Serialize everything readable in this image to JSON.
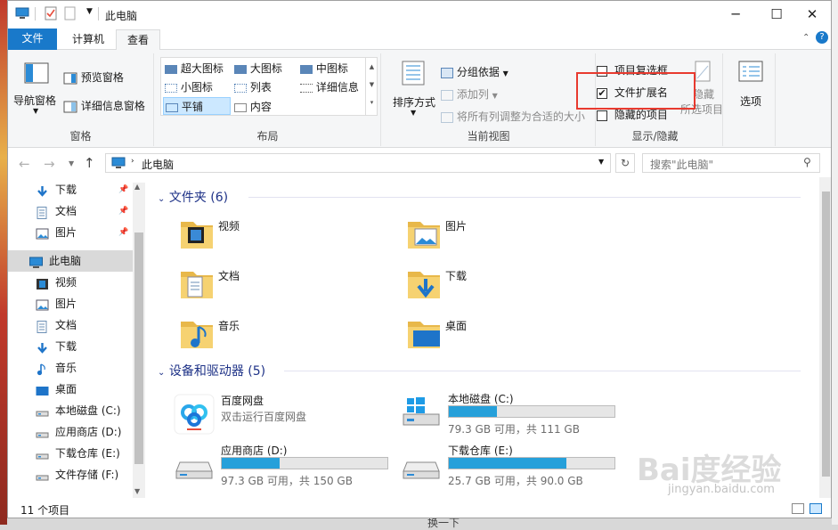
{
  "window": {
    "title": "此电脑"
  },
  "window_buttons": {
    "minimize": "─",
    "maximize": "☐",
    "close": "✕"
  },
  "tabs": [
    {
      "label": "文件"
    },
    {
      "label": "计算机"
    },
    {
      "label": "查看"
    }
  ],
  "ribbon": {
    "panes": {
      "nav_pane": "导航窗格",
      "preview_pane": "预览窗格",
      "details_pane": "详细信息窗格",
      "group_label": "窗格"
    },
    "layout": {
      "extra_large": "超大图标",
      "large": "大图标",
      "medium": "中图标",
      "small": "小图标",
      "list": "列表",
      "details": "详细信息",
      "tiles": "平铺",
      "content": "内容",
      "group_label": "布局"
    },
    "current_view": {
      "sort_by": "排序方式",
      "group_by": "分组依据",
      "add_columns": "添加列",
      "size_columns": "将所有列调整为合适的大小",
      "group_label": "当前视图"
    },
    "show_hide": {
      "item_checkboxes": "项目复选框",
      "file_extensions": "文件扩展名",
      "hidden_items": "隐藏的项目",
      "hide_selected_1": "隐藏",
      "hide_selected_2": "所选项目",
      "group_label": "显示/隐藏"
    },
    "options": {
      "label": "选项"
    }
  },
  "address": {
    "path": "此电脑",
    "search_placeholder": "搜索\"此电脑\""
  },
  "sidebar": {
    "items": [
      {
        "label": "下载",
        "icon": "download-icon",
        "pinned": true
      },
      {
        "label": "文档",
        "icon": "document-icon",
        "pinned": true
      },
      {
        "label": "图片",
        "icon": "picture-icon",
        "pinned": true
      },
      {
        "label": "此电脑",
        "icon": "computer-icon",
        "selected": true
      },
      {
        "label": "视频",
        "icon": "video-icon"
      },
      {
        "label": "图片",
        "icon": "picture-icon"
      },
      {
        "label": "文档",
        "icon": "document-icon"
      },
      {
        "label": "下载",
        "icon": "download-icon"
      },
      {
        "label": "音乐",
        "icon": "music-icon"
      },
      {
        "label": "桌面",
        "icon": "desktop-icon"
      },
      {
        "label": "本地磁盘 (C:)",
        "icon": "drive-icon"
      },
      {
        "label": "应用商店 (D:)",
        "icon": "drive-icon"
      },
      {
        "label": "下载仓库 (E:)",
        "icon": "drive-icon"
      },
      {
        "label": "文件存储 (F:)",
        "icon": "drive-icon"
      }
    ]
  },
  "main": {
    "folders_header": "文件夹 (6)",
    "folders": [
      {
        "label": "视频",
        "icon": "video-folder-icon"
      },
      {
        "label": "图片",
        "icon": "picture-folder-icon"
      },
      {
        "label": "文档",
        "icon": "document-folder-icon"
      },
      {
        "label": "下载",
        "icon": "download-folder-icon"
      },
      {
        "label": "音乐",
        "icon": "music-folder-icon"
      },
      {
        "label": "桌面",
        "icon": "desktop-folder-icon"
      }
    ],
    "devices_header": "设备和驱动器 (5)",
    "devices": [
      {
        "label": "百度网盘",
        "sub": "双击运行百度网盘",
        "icon": "baidu-netdisk-icon"
      },
      {
        "label": "本地磁盘 (C:)",
        "sub": "79.3 GB 可用，共 111 GB",
        "fill": 0.29,
        "icon": "windows-drive-icon"
      },
      {
        "label": "应用商店 (D:)",
        "sub": "97.3 GB 可用，共 150 GB",
        "fill": 0.35,
        "icon": "drive-icon"
      },
      {
        "label": "下载仓库 (E:)",
        "sub": "25.7 GB 可用，共 90.0 GB",
        "fill": 0.71,
        "icon": "drive-icon"
      }
    ]
  },
  "status": {
    "count": "11 个项目"
  },
  "behind": {
    "text": "换一下"
  },
  "watermark": {
    "logo": "Bai度经验",
    "url": "jingyan.baidu.com"
  },
  "colors": {
    "accent": "#1979ca",
    "bar_fill": "#26a0da",
    "highlight_box": "#e83a2f"
  }
}
